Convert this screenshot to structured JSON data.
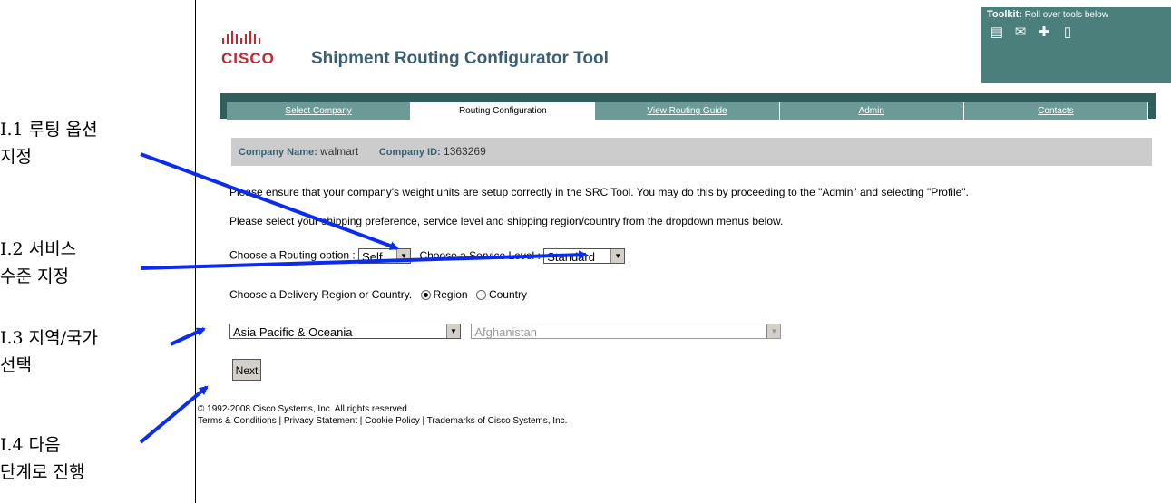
{
  "header": {
    "logo_text": "CISCO",
    "title": "Shipment Routing Configurator Tool"
  },
  "toolkit": {
    "label_bold": "Toolkit:",
    "label_rest": "Roll over tools below",
    "icons": [
      "print-icon",
      "mail-icon",
      "add-icon",
      "document-icon"
    ]
  },
  "tabs": [
    "Select Company",
    "Routing Configuration",
    "View Routing Guide",
    "Admin",
    "Contacts"
  ],
  "company": {
    "name_label": "Company Name:",
    "name_value": "walmart",
    "id_label": "Company ID:",
    "id_value": "1363269"
  },
  "instructions": {
    "weight": "Please ensure that your company's weight units are setup correctly in the SRC Tool. You may do this by proceeding to the \"Admin\" and selecting \"Profile\".",
    "select": "Please select your shipping preference, service level and shipping region/country from the dropdown menus below."
  },
  "form": {
    "routing_label": "Choose a Routing option :",
    "routing_value": "Self",
    "service_label": "Choose a Service Level :",
    "service_value": "Standard",
    "delivery_label": "Choose a Delivery Region or Country.",
    "radio_region": "Region",
    "radio_country": "Country",
    "region_value": "Asia Pacific & Oceania",
    "country_value": "Afghanistan",
    "next_label": "Next"
  },
  "footer": {
    "copyright": "© 1992-2008 Cisco Systems, Inc. All rights reserved.",
    "links": [
      "Terms & Conditions",
      "Privacy Statement",
      "Cookie Policy",
      "Trademarks of Cisco Systems, Inc."
    ]
  },
  "annotations": [
    {
      "line1": "I.1 루팅 옵션",
      "line2": "지정"
    },
    {
      "line1": "I.2 서비스",
      "line2": "수준 지정"
    },
    {
      "line1": "I.3 지역/국가",
      "line2": "선택"
    },
    {
      "line1": "I.4 다음",
      "line2": "단계로 진행"
    }
  ],
  "colors": {
    "accent": "#3a5f74",
    "nav": "#2f5e5c",
    "tab": "#6c9b97",
    "toolkit": "#4a7f7c",
    "arrow": "#0a2cf0",
    "logo": "#c0282d"
  }
}
